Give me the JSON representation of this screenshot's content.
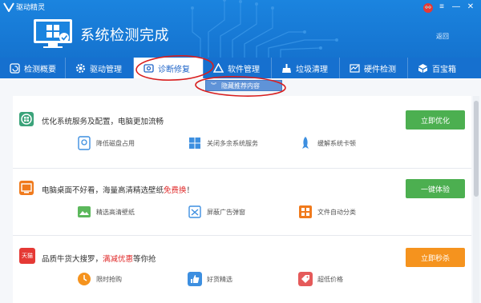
{
  "app": {
    "title": "驱动精灵"
  },
  "header": {
    "status_title": "系统检测完成",
    "back_label": "返回"
  },
  "tabs": [
    {
      "label": "检测概要",
      "icon": "refresh-icon"
    },
    {
      "label": "驱动管理",
      "icon": "gear-icon"
    },
    {
      "label": "诊断修复",
      "icon": "toolbox-icon",
      "active": true
    },
    {
      "label": "软件管理",
      "icon": "app-icon"
    },
    {
      "label": "垃圾清理",
      "icon": "broom-icon"
    },
    {
      "label": "硬件检测",
      "icon": "chart-icon"
    },
    {
      "label": "百宝箱",
      "icon": "box-icon"
    }
  ],
  "dropdown": {
    "hide_label": "隐藏推荐内容"
  },
  "cards": [
    {
      "title": "优化系统服务及配置，电脑更加流畅",
      "button": "立即优化",
      "button_color": "#4caf50",
      "subs": [
        "降低磁盘占用",
        "关闭多余系统服务",
        "缓解系统卡顿"
      ]
    },
    {
      "title_pre": "电脑桌面不好看，海量高清精选壁纸",
      "title_hl": "免费换",
      "title_post": "！",
      "button": "一键体验",
      "button_color": "#4caf50",
      "subs": [
        "精选高清壁纸",
        "屏蔽广告弹窗",
        "文件自动分类"
      ]
    },
    {
      "icon_text": "天猫",
      "title_pre": "品质牛货大搜罗，",
      "title_hl": "满减优惠",
      "title_post": "等你抢",
      "button": "立即秒杀",
      "button_color": "#f5931e",
      "subs": [
        "限时抢购",
        "好货精选",
        "超低价格"
      ]
    }
  ],
  "colors": {
    "header_blue": "#1b84df",
    "tab_blue": "#1670cf",
    "green": "#4caf50",
    "orange": "#f5931e",
    "red_highlight": "#e02c2c"
  }
}
